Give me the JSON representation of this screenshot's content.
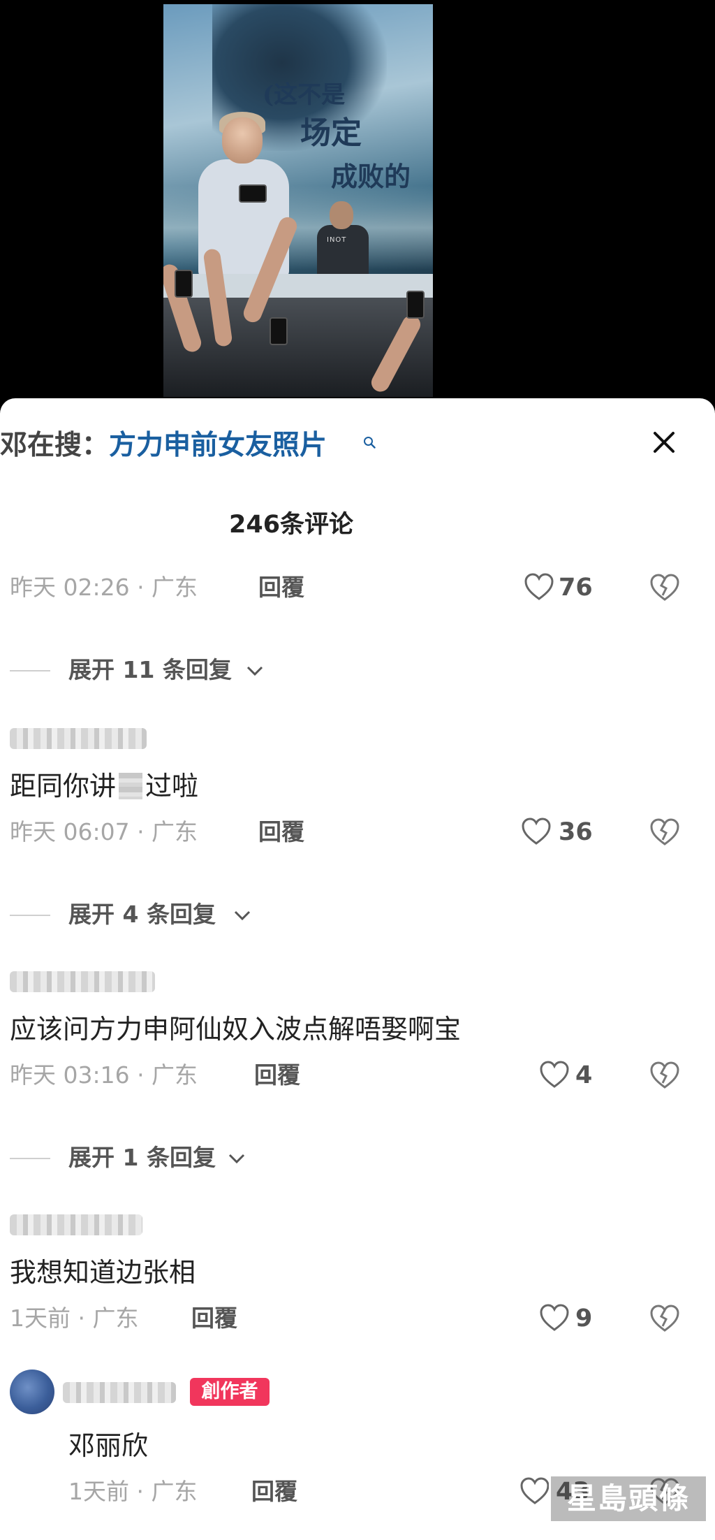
{
  "video": {
    "overlay_line1": "(这不是",
    "overlay_line2": "场定",
    "overlay_line3": "成败的",
    "shirt_text": "INOT"
  },
  "search_suggest": {
    "prefix": "邓在搜：",
    "query": "方力申前女友照片"
  },
  "comments_count": "246条评论",
  "items": {
    "c1": {
      "meta": "昨天 02:26 · 广东",
      "reply": "回覆",
      "likes": "76",
      "expand": "展开 11 条回复"
    },
    "c2": {
      "text_a": "距同你讲",
      "text_b": "过啦",
      "meta": "昨天 06:07 · 广东",
      "reply": "回覆",
      "likes": "36",
      "expand": "展开 4 条回复"
    },
    "c3": {
      "text": "应该问方力申阿仙奴入波点解唔娶啊宝",
      "meta": "昨天 03:16 · 广东",
      "reply": "回覆",
      "likes": "4",
      "expand": "展开 1 条回复"
    },
    "c4": {
      "text": "我想知道边张相",
      "meta": "1天前 · 广东",
      "reply": "回覆",
      "likes": "9"
    },
    "c5": {
      "badge": "創作者",
      "text": "邓丽欣",
      "meta": "1天前 · 广东",
      "reply": "回覆",
      "likes": "43"
    }
  },
  "watermark": "星島頭條",
  "colors": {
    "link": "#1a5fa0",
    "badge": "#f1365c",
    "meta": "#a6a6a6"
  },
  "icons": [
    "search-icon",
    "close-icon",
    "heart-icon",
    "broken-heart-icon",
    "chevron-down-icon"
  ]
}
